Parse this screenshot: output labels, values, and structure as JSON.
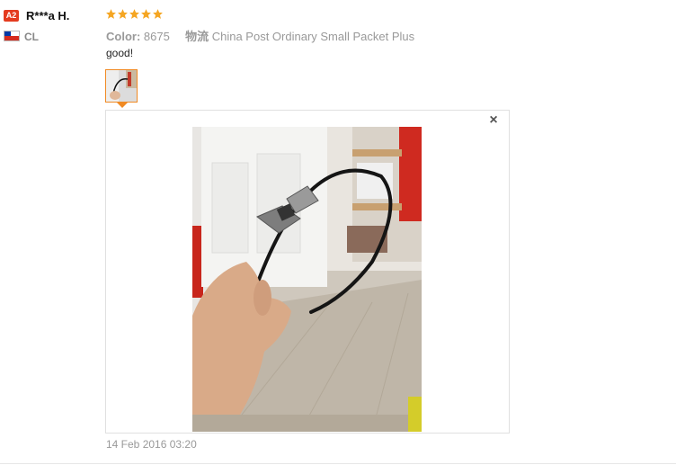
{
  "reviewer": {
    "badge": "A2",
    "name": "R***a H.",
    "country": "CL"
  },
  "rating": {
    "stars": 5,
    "max": 5,
    "color": "#f5a623"
  },
  "meta": {
    "color_label": "Color:",
    "color_value": "8675",
    "shipping_label": "物流",
    "shipping_value": "China Post Ordinary Small Packet Plus"
  },
  "review": {
    "text": "good!"
  },
  "attachments": {
    "selected_index": 0,
    "count": 1
  },
  "viewer": {
    "close_glyph": "×"
  },
  "date": "14 Feb 2016 03:20",
  "colors": {
    "accent": "#f08a24",
    "badge": "#e43b1f"
  }
}
